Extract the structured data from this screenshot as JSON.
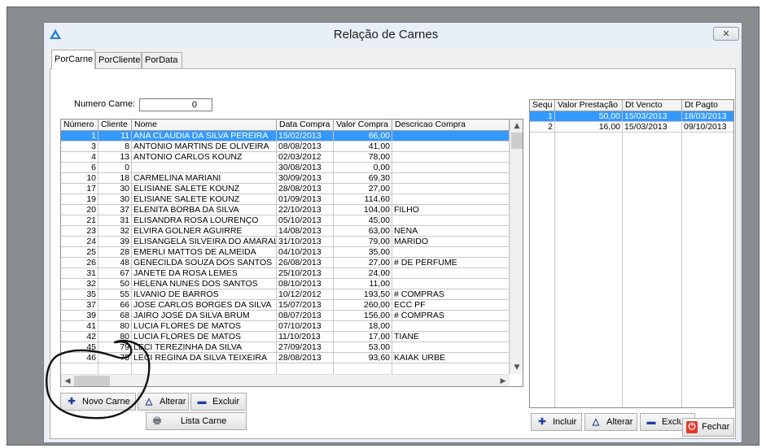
{
  "window": {
    "title": "Relação de Carnes",
    "close_glyph": "✕"
  },
  "tabs": [
    {
      "label": "PorCarne",
      "active": true
    },
    {
      "label": "PorCliente",
      "active": false
    },
    {
      "label": "PorData",
      "active": false
    }
  ],
  "filter": {
    "label": "Numero Carne:",
    "value": "0"
  },
  "carnes_table": {
    "columns": [
      "Número",
      "Cliente",
      "Nome",
      "Data Compra",
      "Valor Compra",
      "Descricao Compra"
    ],
    "rows": [
      {
        "numero": "1",
        "cliente": "11",
        "nome": "ANA CLAUDIA DA SILVA PEREIRA",
        "data": "15/02/2013",
        "valor": "66,00",
        "descricao": "",
        "selected": true
      },
      {
        "numero": "3",
        "cliente": "8",
        "nome": "ANTONIO  MARTINS DE OLIVEIRA",
        "data": "08/08/2013",
        "valor": "41,00",
        "descricao": ""
      },
      {
        "numero": "4",
        "cliente": "13",
        "nome": "ANTONIO CARLOS KOUNZ",
        "data": "02/03/2012",
        "valor": "78,00",
        "descricao": ""
      },
      {
        "numero": "6",
        "cliente": "0",
        "nome": "",
        "data": "30/08/2013",
        "valor": "0,00",
        "descricao": ""
      },
      {
        "numero": "10",
        "cliente": "18",
        "nome": "CARMELINA MARIANI",
        "data": "30/09/2013",
        "valor": "69,30",
        "descricao": ""
      },
      {
        "numero": "17",
        "cliente": "30",
        "nome": "ELISIANE SALETE KOUNZ",
        "data": "28/08/2013",
        "valor": "27,00",
        "descricao": ""
      },
      {
        "numero": "19",
        "cliente": "30",
        "nome": "ELISIANE SALETE KOUNZ",
        "data": "01/09/2013",
        "valor": "114,60",
        "descricao": ""
      },
      {
        "numero": "20",
        "cliente": "37",
        "nome": "ELENITA BORBA DA SILVA",
        "data": "22/10/2013",
        "valor": "104,00",
        "descricao": "FILHO"
      },
      {
        "numero": "21",
        "cliente": "31",
        "nome": "ELISANDRA ROSA LOURENÇO",
        "data": "05/10/2013",
        "valor": "45,00",
        "descricao": ""
      },
      {
        "numero": "23",
        "cliente": "32",
        "nome": "ELVIRA GOLNER AGUIRRE",
        "data": "14/08/2013",
        "valor": "63,00",
        "descricao": "NENA"
      },
      {
        "numero": "24",
        "cliente": "39",
        "nome": "ELISANGELA SILVEIRA DO AMARAL",
        "data": "31/10/2013",
        "valor": "79,00",
        "descricao": "MARIDO"
      },
      {
        "numero": "25",
        "cliente": "28",
        "nome": "EMERLI MATTOS DE ALMEIDA",
        "data": "04/10/2013",
        "valor": "35,00",
        "descricao": ""
      },
      {
        "numero": "26",
        "cliente": "48",
        "nome": "GENECILDA SOUZA DOS SANTOS",
        "data": "26/08/2013",
        "valor": "27,00",
        "descricao": "# DE PERFUME"
      },
      {
        "numero": "31",
        "cliente": "67",
        "nome": "JANETE DA ROSA  LEMES",
        "data": "25/10/2013",
        "valor": "24,00",
        "descricao": ""
      },
      {
        "numero": "32",
        "cliente": "50",
        "nome": "HELENA NUNES DOS SANTOS",
        "data": "08/10/2013",
        "valor": "11,00",
        "descricao": ""
      },
      {
        "numero": "35",
        "cliente": "55",
        "nome": "ILVANIO DE BARROS",
        "data": "10/12/2012",
        "valor": "193,50",
        "descricao": "# COMPRAS"
      },
      {
        "numero": "37",
        "cliente": "66",
        "nome": "JOSE CARLOS BORGES DA SILVA",
        "data": "15/07/2013",
        "valor": "260,00",
        "descricao": "ECC PF"
      },
      {
        "numero": "39",
        "cliente": "68",
        "nome": "JAIRO JOSÉ  DA SILVA BRUM",
        "data": "08/07/2013",
        "valor": "156,00",
        "descricao": "# COMPRAS"
      },
      {
        "numero": "41",
        "cliente": "80",
        "nome": "LUCIA FLORES DE MATOS",
        "data": "07/10/2013",
        "valor": "18,00",
        "descricao": ""
      },
      {
        "numero": "42",
        "cliente": "80",
        "nome": "LUCIA FLORES DE MATOS",
        "data": "11/10/2013",
        "valor": "17,00",
        "descricao": "TIANE"
      },
      {
        "numero": "45",
        "cliente": "79",
        "nome": "LECI TEREZINHA DA SILVA",
        "data": "27/09/2013",
        "valor": "53,00",
        "descricao": ""
      },
      {
        "numero": "46",
        "cliente": "75",
        "nome": "LECI REGINA DA SILVA TEIXEIRA",
        "data": "28/08/2013",
        "valor": "93,60",
        "descricao": "KAIAK URBE"
      }
    ]
  },
  "parcelas_table": {
    "columns": [
      "Sequ",
      "Valor Prestação",
      "Dt Vencto",
      "Dt Pagto"
    ],
    "rows": [
      {
        "seq": "1",
        "valor": "50,00",
        "vencto": "15/03/2013",
        "pagto": "18/03/2013",
        "selected": true
      },
      {
        "seq": "2",
        "valor": "16,00",
        "vencto": "15/03/2013",
        "pagto": "09/10/2013"
      }
    ]
  },
  "buttons": {
    "novo_carne": "Novo Carne",
    "alterar": "Alterar",
    "excluir": "Excluir",
    "lista_carne": "Lista Carne",
    "incluir": "Incluir",
    "alterar_parcela": "Alterar",
    "excluir_parcela": "Excluir",
    "fechar": "Fechar"
  },
  "scroll_glyphs": {
    "up": "▲",
    "down": "▼",
    "left": "◀",
    "right": "▶"
  }
}
